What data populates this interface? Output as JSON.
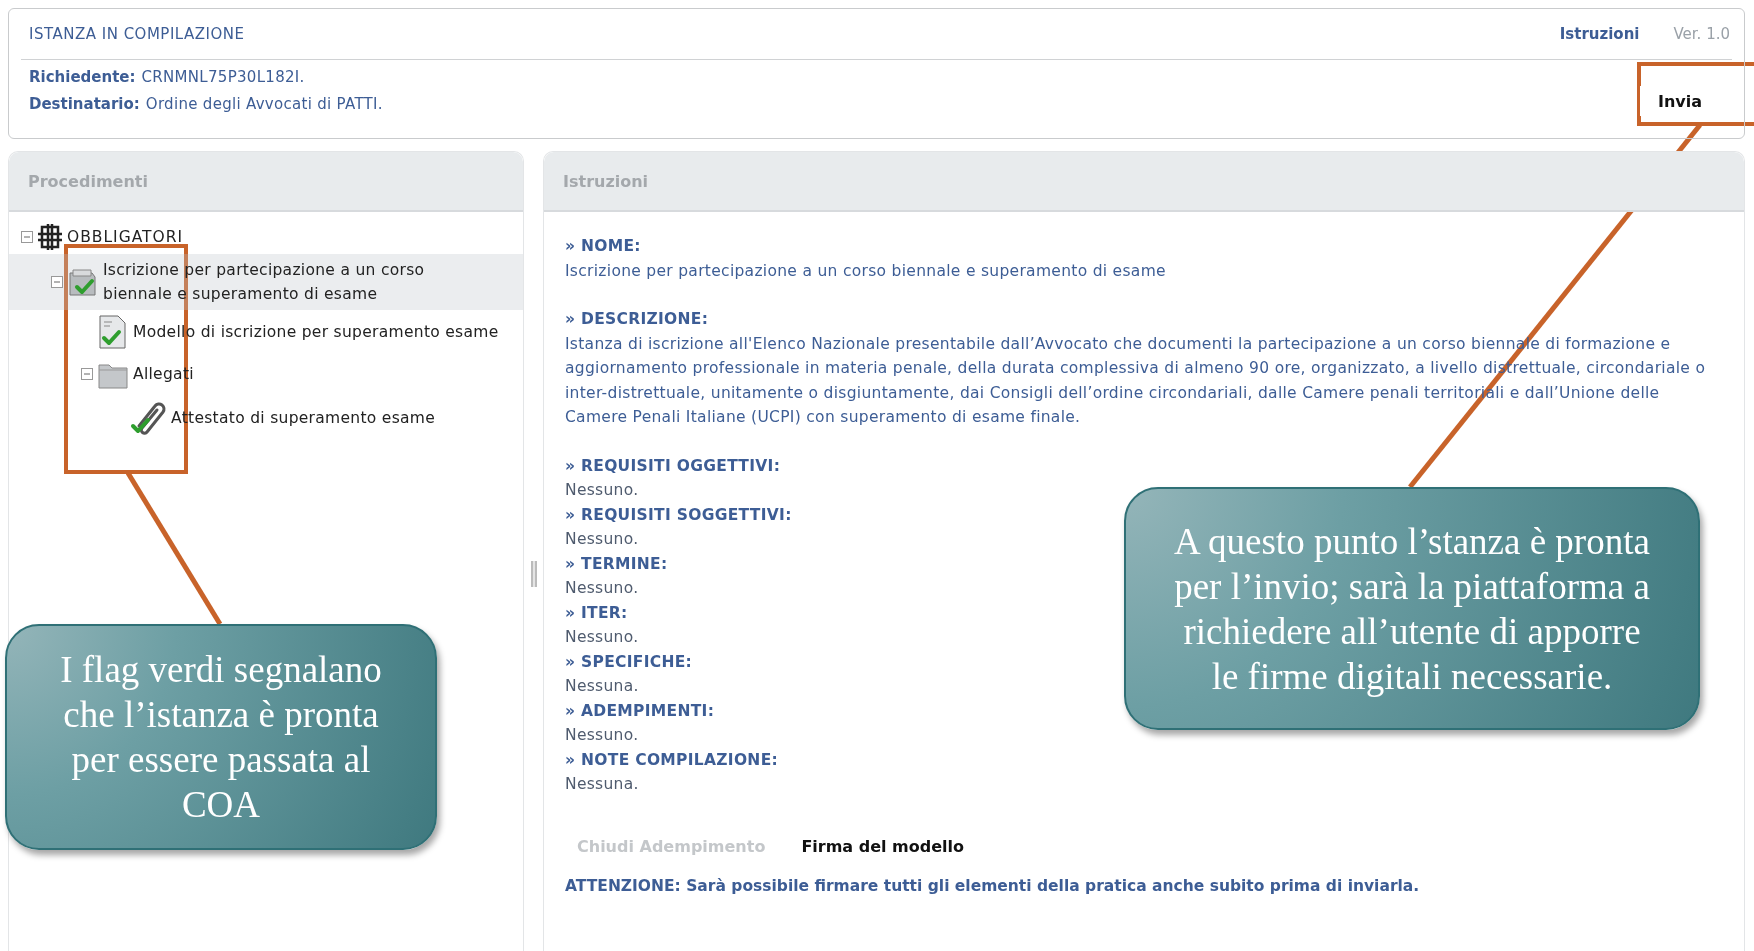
{
  "header": {
    "title": "ISTANZA IN COMPILAZIONE",
    "links": [
      {
        "label": "Istruzioni",
        "kind": "link"
      },
      {
        "label": "Ver. 1.0",
        "kind": "version"
      }
    ],
    "fields": [
      {
        "label": "Richiedente:",
        "value": "CRNMNL75P30L182I."
      },
      {
        "label": "Destinatario:",
        "value": "Ordine degli Avvocati di PATTI."
      }
    ],
    "send_button": "Invia"
  },
  "procedimenti": {
    "title": "Procedimenti",
    "tree": [
      {
        "label": "OBBLIGATORI",
        "kind": "group",
        "expanded": true,
        "selected": false,
        "children": [
          {
            "label": "Iscrizione per partecipazione a un corso biennale e superamento di esame",
            "kind": "instance",
            "complete": true,
            "expanded": true,
            "selected": true,
            "children": [
              {
                "label": "Modello di iscrizione per superamento esame",
                "kind": "document",
                "complete": true,
                "selected": false
              },
              {
                "label": "Allegati",
                "kind": "folder",
                "expanded": true,
                "selected": false,
                "children": [
                  {
                    "label": "Attestato di superamento esame",
                    "kind": "attachment",
                    "complete": true,
                    "selected": false
                  }
                ]
              }
            ]
          }
        ]
      }
    ]
  },
  "istruzioni": {
    "title": "Istruzioni",
    "sections": [
      {
        "heading": "» NOME:",
        "text": "Iscrizione per partecipazione a un corso biennale e superamento di esame",
        "kind": "main"
      },
      {
        "heading": "» DESCRIZIONE:",
        "text": "Istanza di iscrizione all'Elenco Nazionale presentabile dall’Avvocato che documenti la partecipazione a un corso biennale di formazione e aggiornamento professionale in materia penale, della durata complessiva di almeno 90 ore, organizzato, a livello distrettuale, circondariale o inter-distrettuale, unitamente o disgiuntamente, dai Consigli dell’ordine circondariali, dalle Camere penali territoriali e dall’Unione delle Camere Penali Italiane (UCPI) con superamento di esame finale.",
        "kind": "main"
      },
      {
        "heading": "» REQUISITI OGGETTIVI:",
        "text": "Nessuno.",
        "kind": "detail"
      },
      {
        "heading": "» REQUISITI SOGGETTIVI:",
        "text": "Nessuno.",
        "kind": "detail"
      },
      {
        "heading": "» TERMINE:",
        "text": "Nessuno.",
        "kind": "detail"
      },
      {
        "heading": "» ITER:",
        "text": "Nessuno.",
        "kind": "detail"
      },
      {
        "heading": "» SPECIFICHE:",
        "text": "Nessuna.",
        "kind": "detail"
      },
      {
        "heading": "» ADEMPIMENTI:",
        "text": "Nessuno.",
        "kind": "detail"
      },
      {
        "heading": "» NOTE COMPILAZIONE:",
        "text": "Nessuna.",
        "kind": "detail"
      }
    ],
    "actions": [
      {
        "label": "Chiudi Adempimento",
        "disabled": true
      },
      {
        "label": "Firma del modello",
        "disabled": false
      }
    ],
    "warning": "ATTENZIONE: Sarà possibile firmare tutti gli elementi della pratica anche subito prima di inviarla."
  },
  "annotations": [
    {
      "text": "I flag verdi segnalano che l’istanza è pronta per essere passata al COA"
    },
    {
      "text": "A questo punto l’stanza è pronta per l’invio; sarà la piattaforma a richiedere all’utente di apporre le firme digitali necessarie."
    }
  ]
}
